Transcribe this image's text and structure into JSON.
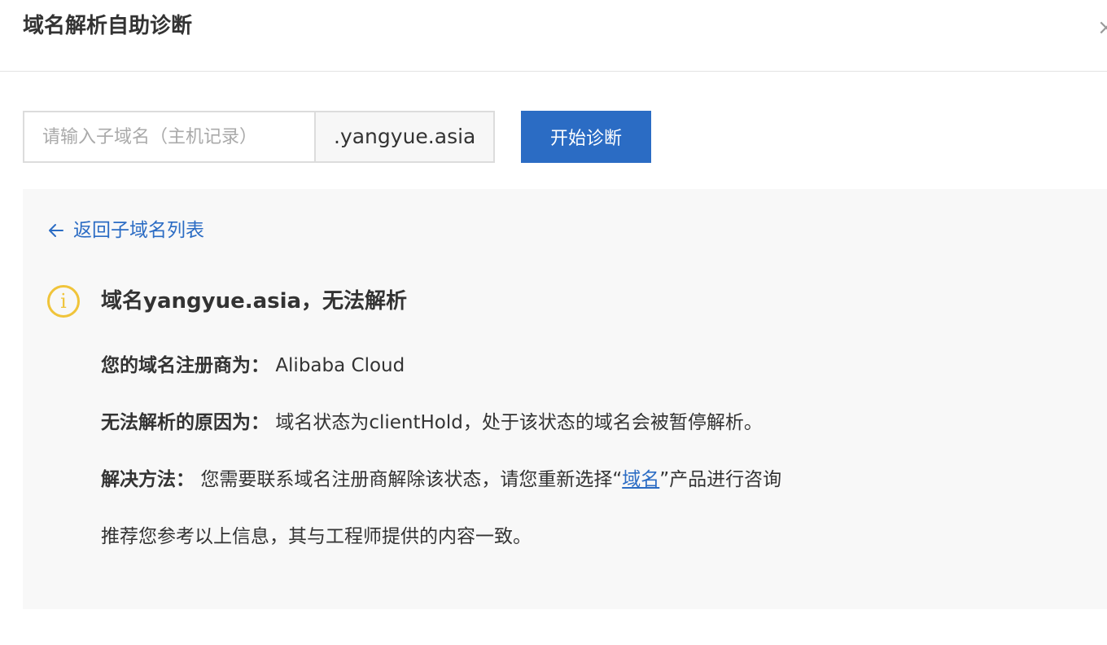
{
  "header": {
    "title": "域名解析自助诊断",
    "close_icon": "close-icon",
    "close_glyph": "×"
  },
  "search": {
    "subdomain_placeholder": "请输入子域名（主机记录）",
    "subdomain_value": "",
    "domain_suffix": ".yangyue.asia",
    "start_button_label": "开始诊断"
  },
  "result": {
    "back_link_label": "返回子域名列表",
    "status_icon": "info-icon",
    "status_icon_glyph": "i",
    "status_color": "#f0c43a",
    "title": "域名yangyue.asia，无法解析",
    "registrar": {
      "label": "您的域名注册商为：",
      "value": "Alibaba Cloud"
    },
    "reason": {
      "label": "无法解析的原因为：",
      "value": "域名状态为clientHold，处于该状态的域名会被暂停解析。"
    },
    "solution": {
      "label": "解决方法：",
      "text_before": "您需要联系域名注册商解除该状态，请您重新选择“",
      "link_text": "域名",
      "text_after": "”产品进行咨询"
    },
    "recommendation": "推荐您参考以上信息，其与工程师提供的内容一致。"
  },
  "colors": {
    "accent": "#2b6cc4",
    "warning": "#f0c43a",
    "panel_bg": "#f8f8f8"
  }
}
